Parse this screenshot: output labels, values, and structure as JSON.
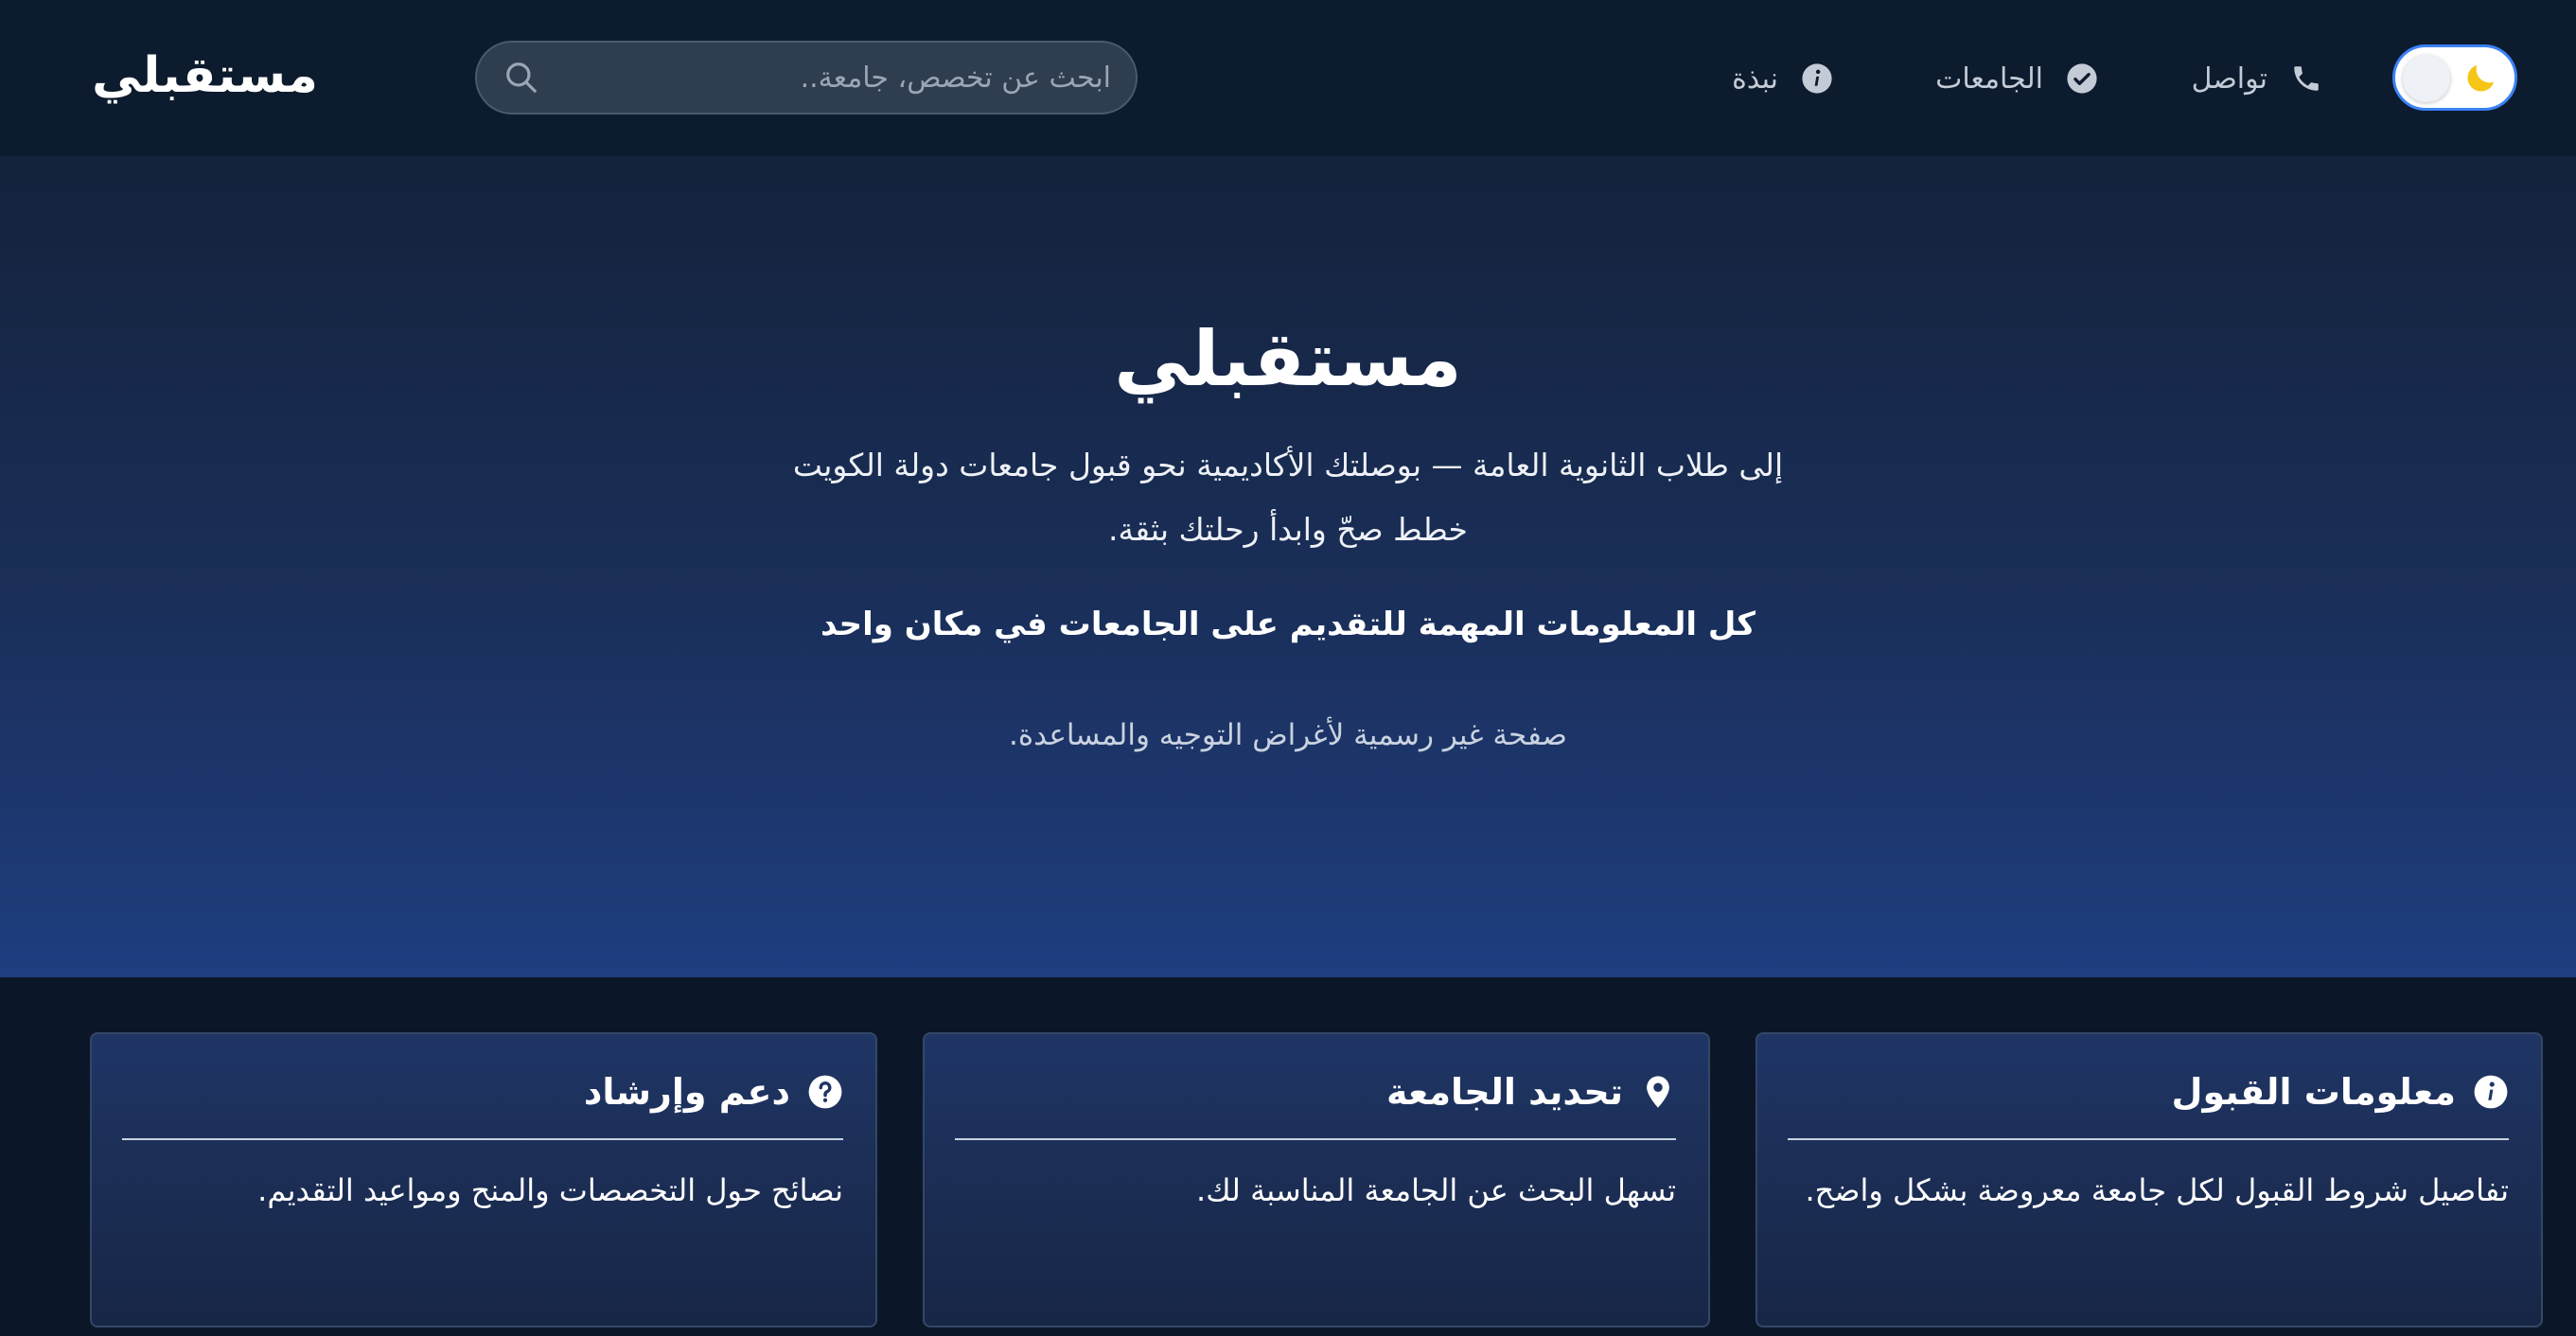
{
  "brand": {
    "name": "مستقبلي"
  },
  "nav": {
    "contact": "تواصل",
    "universities": "الجامعات",
    "about": "نبذة"
  },
  "search": {
    "placeholder": "ابحث عن تخصص، جامعة.."
  },
  "theme_toggle": {
    "icon": "moon-icon",
    "mode": "dark"
  },
  "hero": {
    "title": "مستقبلي",
    "subtitle_line1": "إلى طلاب الثانوية العامة — بوصلتك الأكاديمية نحو قبول جامعات دولة الكويت",
    "subtitle_line2": "خطط صحّ وابدأ رحلتك بثقة.",
    "tagline": "كل المعلومات المهمة للتقديم على الجامعات في مكان واحد",
    "disclaimer": "صفحة غير رسمية لأغراض التوجيه والمساعدة."
  },
  "features": [
    {
      "title": "معلومات القبول",
      "icon": "info-icon",
      "body": "تفاصيل شروط القبول لكل جامعة معروضة بشكل واضح."
    },
    {
      "title": "تحديد الجامعة",
      "icon": "location-pin-icon",
      "body": "تسهل البحث عن الجامعة المناسبة لك."
    },
    {
      "title": "دعم وإرشاد",
      "icon": "question-circle-icon",
      "body": "نصائح حول التخصصات والمنح ومواعيد التقديم."
    }
  ],
  "colors": {
    "navbar_bg": "#0d1b2e",
    "hero_gradient_top": "#14223b",
    "hero_gradient_bottom": "#1f3e80",
    "moon": "#f5c518",
    "toggle_border": "#3b82f6"
  }
}
